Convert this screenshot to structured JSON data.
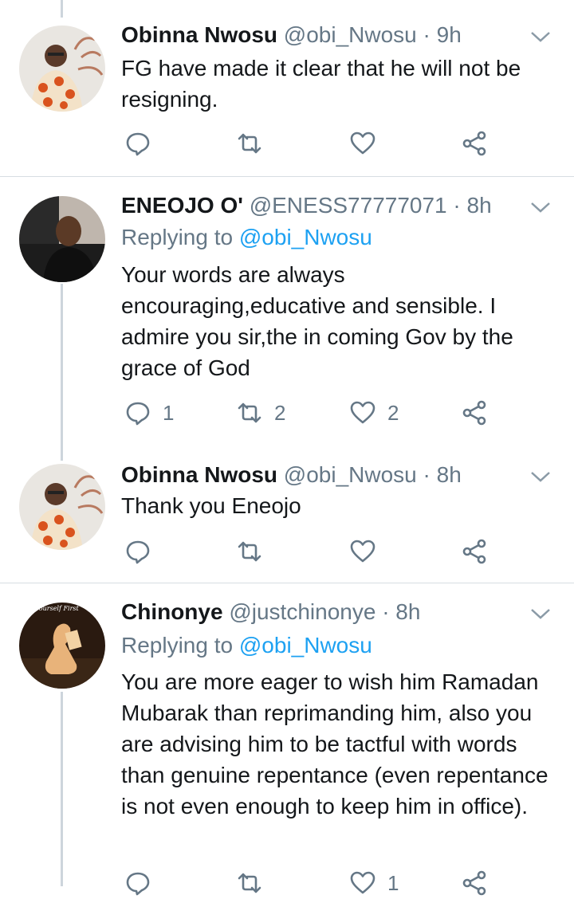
{
  "tweets": [
    {
      "name": "Obinna Nwosu",
      "handle": "@obi_Nwosu",
      "time": "· 9h",
      "text": "FG have made it clear that he will not be resigning.",
      "replying_to_label": "",
      "replying_to_handle": "",
      "counts": {
        "reply": "",
        "retweet": "",
        "like": ""
      }
    },
    {
      "name": "ENEOJO O'",
      "handle": "@ENESS77777071",
      "time": "· 8h",
      "replying_to_label": "Replying to",
      "replying_to_handle": "@obi_Nwosu",
      "text": "Your words are always encouraging,educative and sensible. I admire you sir,the in coming Gov by the grace of God",
      "counts": {
        "reply": "1",
        "retweet": "2",
        "like": "2"
      }
    },
    {
      "name": "Obinna Nwosu",
      "handle": "@obi_Nwosu",
      "time": "· 8h",
      "text": "Thank you Eneojo",
      "replying_to_label": "",
      "replying_to_handle": "",
      "counts": {
        "reply": "",
        "retweet": "",
        "like": ""
      }
    },
    {
      "name": "Chinonye",
      "handle": "@justchinonye",
      "time": "· 8h",
      "replying_to_label": "Replying to",
      "replying_to_handle": "@obi_Nwosu",
      "text": "You are more eager to wish him Ramadan Mubarak than reprimanding him, also you are advising him to be tactful with words than genuine repentance (even repentance is not even enough to keep him in office).",
      "counts": {
        "reply": "",
        "retweet": "",
        "like": "1"
      }
    }
  ],
  "avatar4_caption": "ow Yourself First",
  "colors": {
    "link": "#1da1f2",
    "meta": "#657786",
    "divider": "#d7dde2",
    "thread": "#cdd5dc"
  }
}
